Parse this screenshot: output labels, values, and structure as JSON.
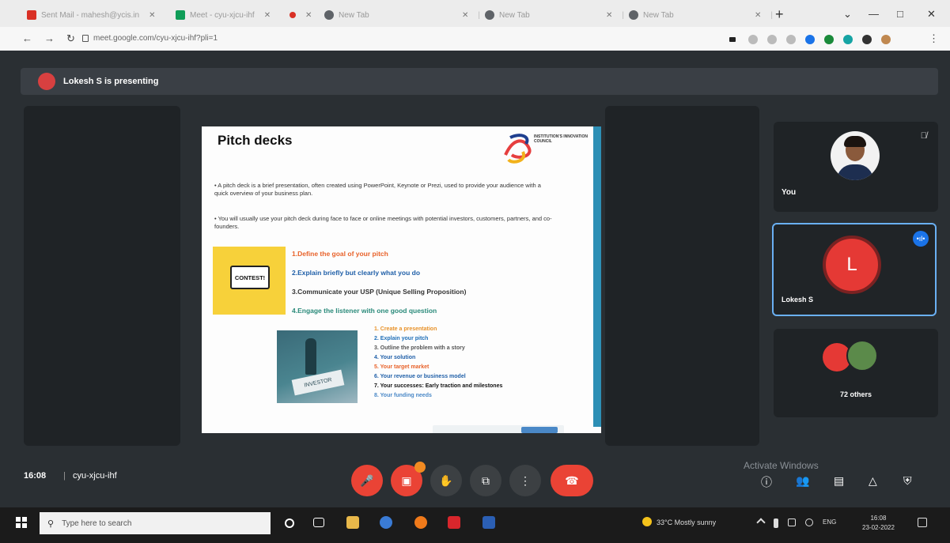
{
  "browser": {
    "tabs": [
      {
        "label": "Sent Mail - mahesh@ycis.in",
        "favicon_color": "#d93025"
      },
      {
        "label": "Meet - cyu-xjcu-ihf",
        "favicon_color": "#0f9d58"
      },
      {
        "label": "",
        "favicon_color": "#d93025"
      },
      {
        "label": "New Tab",
        "favicon_color": "#5f6368"
      },
      {
        "label": "New Tab",
        "favicon_color": "#5f6368"
      },
      {
        "label": "New Tab",
        "favicon_color": "#5f6368"
      }
    ],
    "new_tab_icon": "+",
    "url": "meet.google.com/cyu-xjcu-ihf?pli=1",
    "window_controls": [
      "—",
      "□",
      "✕"
    ]
  },
  "meet": {
    "presenting_text": "Lokesh S is presenting",
    "slide": {
      "title": "Pitch decks",
      "logo_text": "INSTITUTION'S INNOVATION COUNCIL",
      "bullets": [
        "A pitch deck is a brief presentation, often created using PowerPoint, Keynote or Prezi, used to provide your audience with a quick overview of your business plan.",
        "You will usually use your pitch deck during face to face or online meetings with potential investors, customers, partners, and co-founders."
      ],
      "contest_label": "CONTEST!",
      "steps": [
        {
          "text": "1.Define the goal of your pitch",
          "color": "#e8622a"
        },
        {
          "text": "2.Explain briefly but clearly what you do",
          "color": "#1f5fa8"
        },
        {
          "text": "3.Communicate your USP (Unique Selling Proposition)",
          "color": "#333333"
        },
        {
          "text": "4.Engage the listener with one good question",
          "color": "#2a8a7a"
        }
      ],
      "chess_caption": "INVESTOR",
      "sub_steps": [
        {
          "text": "1.  Create a presentation",
          "color": "#e8922a"
        },
        {
          "text": "2.  Explain your pitch",
          "color": "#1f6fb8"
        },
        {
          "text": "3.  Outline the problem with a story",
          "color": "#555555"
        },
        {
          "text": "4.  Your solution",
          "color": "#1f5fa8"
        },
        {
          "text": "5.  Your target market",
          "color": "#e8622a"
        },
        {
          "text": "6.  Your revenue or business model",
          "color": "#1f5fa8"
        },
        {
          "text": "7.  Your successes: Early traction and milestones",
          "color": "#111111"
        },
        {
          "text": "8.  Your funding needs",
          "color": "#4a88c7"
        }
      ]
    },
    "participants": {
      "you_label": "You",
      "lokesh_label": "Lokesh S",
      "lokesh_initial": "L",
      "others_label": "72 others"
    },
    "meeting_time": "16:08",
    "meeting_separator": "|",
    "meeting_code": "cyu-xjcu-ihf",
    "activate_windows": "Activate Windows"
  },
  "taskbar": {
    "search_placeholder": "Type here to search",
    "weather": "33°C  Mostly sunny",
    "tray": "ENG",
    "time": "16:08",
    "date": "23-02-2022"
  }
}
